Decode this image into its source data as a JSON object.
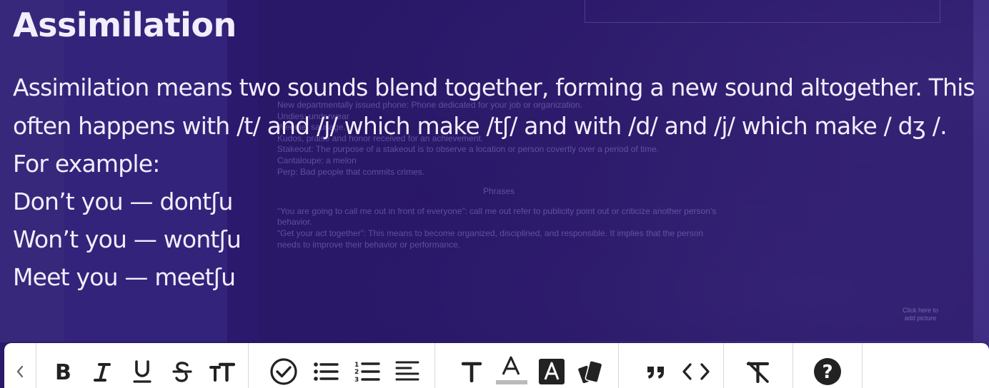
{
  "note": {
    "title": "Assimilation",
    "paragraph": "Assimilation means two sounds blend together, forming a new sound altogether. This often happens with /t/ and /j/ which make /tʃ/ and with /d/ and /j/ which make / dʒ /.",
    "lines": [
      "For example:",
      "Don’t you — dontʃu",
      "Won’t you — wontʃu",
      "Meet you — meetʃu"
    ]
  },
  "background_doc": {
    "lines": [
      "New departmentally issued phone: Phone dedicated for your job or organization.",
      "Undies: underwear",
      "Weenie: sausage.",
      "Kudos, praise and honor received for an achievement.",
      "Stakeout: The purpose of a stakeout is to observe a location or person covertly over a period of time.",
      "Cantaloupe: a melon",
      "Perp: Bad people that commits crimes."
    ],
    "section_heading": "Phrases",
    "phrases": [
      "“You are going to call me out in front of everyone”: call me out refer to publicity point out or criticize another person’s behavior.",
      "“Get your act together”: This means to become organized, disciplined, and responsible. It implies that the person needs to improve their behavior or performance."
    ],
    "side_note": "Click here to add picture"
  },
  "toolbar": {
    "icons": {
      "collapse": "chevron-left-icon",
      "bold": "bold-icon",
      "italic": "italic-icon",
      "underline": "underline-icon",
      "strikethrough": "strikethrough-icon",
      "text_size": "text-size-icon",
      "checklist": "checkbox-circle-icon",
      "bullet_list": "bullet-list-icon",
      "numbered_list": "numbered-list-icon",
      "align": "align-left-icon",
      "text_style": "text-style-icon",
      "text_color": "text-color-icon",
      "highlight": "highlight-color-icon",
      "card_style": "card-style-icon",
      "quote": "quote-icon",
      "code": "code-icon",
      "clear_format": "clear-format-icon",
      "help": "help-icon"
    },
    "text_color_swatch": "#bbbbbb"
  },
  "colors": {
    "background": "#2a1a6b",
    "text": "#f2eefc",
    "toolbar_bg": "#ffffff"
  }
}
